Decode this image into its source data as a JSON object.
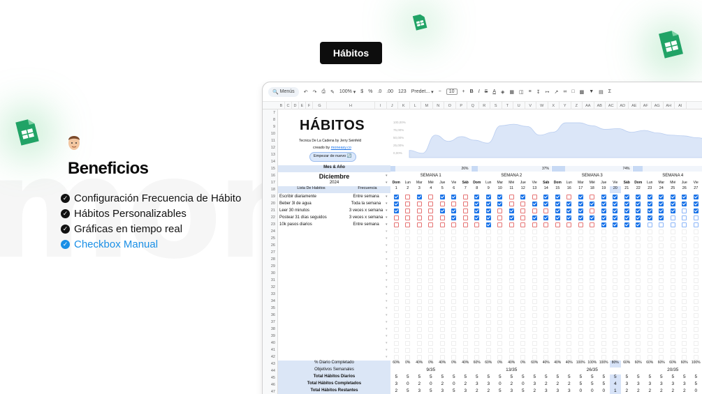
{
  "pill_label": "Hábitos",
  "background_word": "mon",
  "benefits": {
    "heading": "Beneficios",
    "items": [
      {
        "label": "Configuración Frecuencia de Hábito",
        "accent": false
      },
      {
        "label": "Hábitos Personalizables",
        "accent": false
      },
      {
        "label": "Gráficas en tiempo real",
        "accent": false
      },
      {
        "label": "Checkbox Manual",
        "accent": true
      }
    ]
  },
  "colors": {
    "accent_blue": "#1a8fe6",
    "checkbox_blue": "#1a73e8",
    "sheets_green": "#21a366",
    "unchecked_red": "#e57373"
  },
  "toolbar": {
    "menus_label": "Menús",
    "zoom": "100%",
    "currency": "$",
    "percent": "%",
    "decimals_less": ".0",
    "decimals_more": ".00",
    "number_format": "123",
    "font": "Predet...",
    "font_size": "10"
  },
  "column_letters": [
    "B",
    "C",
    "D",
    "E",
    "F",
    "G",
    "H",
    "I",
    "J",
    "K",
    "L",
    "M",
    "N",
    "O",
    "P",
    "Q",
    "R",
    "S",
    "T",
    "U",
    "V",
    "W",
    "X",
    "Y",
    "Z",
    "AA",
    "AB",
    "AC",
    "AD",
    "AE",
    "AF",
    "AG",
    "AH",
    "AI"
  ],
  "row_numbers": [
    7,
    8,
    9,
    10,
    11,
    12,
    13,
    14,
    15,
    16,
    17,
    18,
    19,
    20,
    21,
    22,
    23,
    24,
    25,
    26,
    27,
    28,
    29,
    30,
    31,
    32,
    33,
    34,
    35,
    36,
    37,
    38,
    39,
    40,
    41,
    42,
    43,
    44,
    45,
    46,
    47
  ],
  "header": {
    "title": "HÁBITOS",
    "subtitle": "Tecnica De La Cadena by Jerry Seinfeld",
    "created_by_prefix": "creado by ",
    "created_by_link": "moneasy.co",
    "restart_button": "Empezar de nuevo 🔄"
  },
  "area_chart_ticks": [
    "100,00%",
    "75,00%",
    "50,00%",
    "25,00%",
    "0,00%"
  ],
  "area_chart": {
    "type": "area",
    "y": [
      20,
      12,
      62,
      45,
      58,
      48,
      40,
      88,
      92,
      86,
      62,
      70,
      96,
      96,
      88,
      78,
      80,
      70,
      75,
      68,
      62,
      60,
      55,
      50
    ],
    "ylim": [
      0,
      100
    ]
  },
  "month_year_label": "Mes & Año",
  "month": "Diciembre",
  "year": "2024",
  "habit_list_header": "Lista De Habitos",
  "frequency_header": "Frecuencia",
  "habits": [
    {
      "name": "Escribir diariamente",
      "freq": "Entre semana"
    },
    {
      "name": "Beber 3l de agua",
      "freq": "Toda la semana"
    },
    {
      "name": "Leer 30 minutos",
      "freq": "3 veces x semana"
    },
    {
      "name": "Postear 31 días seguidos",
      "freq": "3 veces x semana"
    },
    {
      "name": "10k pasos diarios",
      "freq": "Entre semana"
    }
  ],
  "weeks": [
    {
      "label": "SEMANA 1",
      "progress": "26%",
      "progress_value": 26,
      "objective": "9/35"
    },
    {
      "label": "SEMANA 2",
      "progress": "37%",
      "progress_value": 37,
      "objective": "13/35"
    },
    {
      "label": "SEMANA 3",
      "progress": "74%",
      "progress_value": 74,
      "objective": "26/35"
    },
    {
      "label": "SEMANA 4",
      "progress": "",
      "progress_value": 57,
      "objective": "20/35"
    }
  ],
  "day_names": [
    "Dom",
    "Lun",
    "Mar",
    "Mié",
    "Jue",
    "Vie",
    "Sáb",
    "Dom",
    "Lun",
    "Mar",
    "Mié",
    "Jue",
    "Vie",
    "Sáb",
    "Dom",
    "Lun",
    "Mar",
    "Mié",
    "Jue",
    "Vie",
    "Sáb",
    "Dom",
    "Lun",
    "Mar",
    "Mié",
    "Jue",
    "Vie"
  ],
  "day_numbers": [
    "1",
    "2",
    "3",
    "4",
    "5",
    "6",
    "7",
    "8",
    "9",
    "10",
    "11",
    "12",
    "13",
    "14",
    "15",
    "16",
    "17",
    "18",
    "19",
    "20",
    "21",
    "22",
    "23",
    "24",
    "25",
    "26",
    "27"
  ],
  "grid": [
    "1010110111010110101111111111",
    "1000000111001111111111111111",
    "1000110110100011101111111011",
    "0000010110101111111111110001",
    "0000000010000000001111000001"
  ],
  "summary": {
    "daily_completed_label": "% Diario Completado",
    "daily_completed": [
      "60%",
      "0%",
      "40%",
      "0%",
      "40%",
      "0%",
      "40%",
      "60%",
      "60%",
      "0%",
      "40%",
      "0%",
      "60%",
      "40%",
      "40%",
      "40%",
      "100%",
      "100%",
      "100%",
      "80%",
      "60%",
      "60%",
      "60%",
      "60%",
      "60%",
      "60%",
      "100%"
    ],
    "weekly_objectives_label": "Objetivos Semanales",
    "total_daily_label": "Total Hábitos Diarios",
    "total_daily": [
      "5",
      "5",
      "5",
      "5",
      "5",
      "5",
      "5",
      "5",
      "5",
      "5",
      "5",
      "5",
      "5",
      "5",
      "5",
      "5",
      "5",
      "5",
      "5",
      "5",
      "5",
      "5",
      "5",
      "5",
      "5",
      "5",
      "5"
    ],
    "total_completed_label": "Total Hábitos Completados",
    "total_completed": [
      "3",
      "0",
      "2",
      "0",
      "2",
      "0",
      "2",
      "3",
      "3",
      "0",
      "2",
      "0",
      "3",
      "2",
      "2",
      "2",
      "5",
      "5",
      "5",
      "4",
      "3",
      "3",
      "3",
      "3",
      "3",
      "3",
      "5"
    ],
    "total_remaining_label": "Total Hábitos Restantes",
    "total_remaining": [
      "2",
      "5",
      "3",
      "5",
      "3",
      "5",
      "3",
      "2",
      "2",
      "5",
      "3",
      "5",
      "2",
      "3",
      "3",
      "3",
      "0",
      "0",
      "0",
      "1",
      "2",
      "2",
      "2",
      "2",
      "2",
      "2",
      "0"
    ]
  }
}
